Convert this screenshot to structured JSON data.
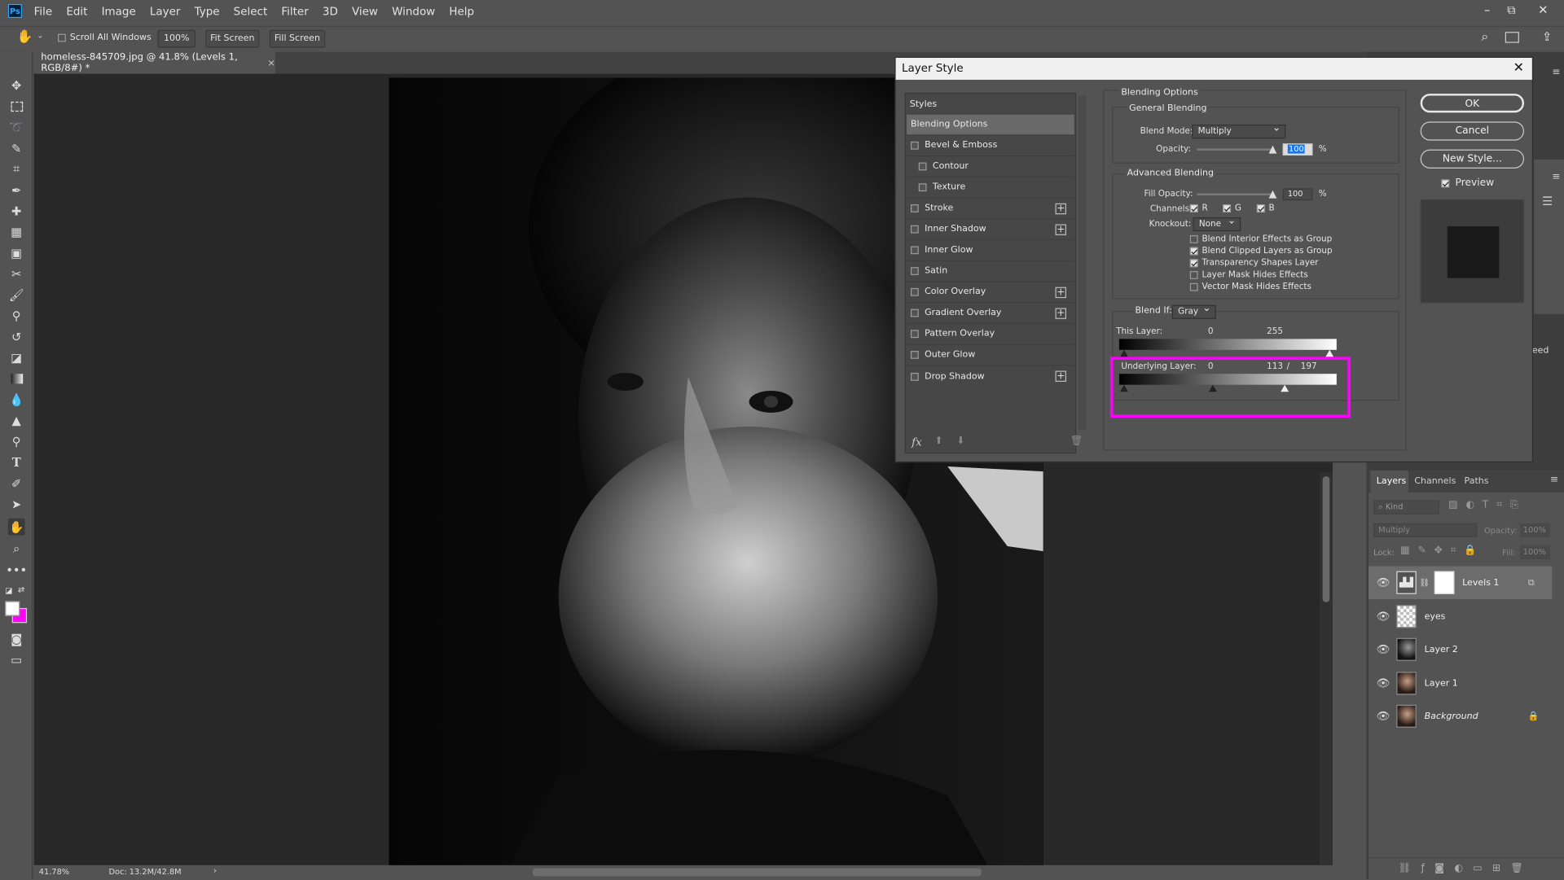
{
  "menubar": {
    "items": [
      "File",
      "Edit",
      "Image",
      "Layer",
      "Type",
      "Select",
      "Filter",
      "3D",
      "View",
      "Window",
      "Help"
    ],
    "logo": "Ps",
    "controls": [
      "–",
      "⧉",
      "✕"
    ]
  },
  "optionsbar": {
    "scroll_all": "Scroll All Windows",
    "zoom": "100%",
    "fit_screen": "Fit Screen",
    "fill_screen": "Fill Screen"
  },
  "document": {
    "tab_title": "homeless-845709.jpg @ 41.8% (Levels 1, RGB/8#) *",
    "close": "×"
  },
  "status": {
    "zoom": "41.78%",
    "doc": "Doc: 13.2M/42.8M"
  },
  "dialog": {
    "title": "Layer Style",
    "styles_header": "Styles",
    "style_items": [
      {
        "label": "Blending Options",
        "checkbox": false,
        "plus": false,
        "active": true
      },
      {
        "label": "Bevel & Emboss",
        "checkbox": true,
        "plus": false
      },
      {
        "label": "Contour",
        "checkbox": true,
        "plus": false,
        "indent": true
      },
      {
        "label": "Texture",
        "checkbox": true,
        "plus": false,
        "indent": true
      },
      {
        "label": "Stroke",
        "checkbox": true,
        "plus": true
      },
      {
        "label": "Inner Shadow",
        "checkbox": true,
        "plus": true
      },
      {
        "label": "Inner Glow",
        "checkbox": true,
        "plus": false
      },
      {
        "label": "Satin",
        "checkbox": true,
        "plus": false
      },
      {
        "label": "Color Overlay",
        "checkbox": true,
        "plus": true
      },
      {
        "label": "Gradient Overlay",
        "checkbox": true,
        "plus": true
      },
      {
        "label": "Pattern Overlay",
        "checkbox": true,
        "plus": false
      },
      {
        "label": "Outer Glow",
        "checkbox": true,
        "plus": false
      },
      {
        "label": "Drop Shadow",
        "checkbox": true,
        "plus": true
      }
    ],
    "fx_label": "fx",
    "blending_options": "Blending Options",
    "general_blending": "General Blending",
    "blend_mode_label": "Blend Mode:",
    "blend_mode": "Multiply",
    "opacity_label": "Opacity:",
    "opacity": "100",
    "percent": "%",
    "advanced_blending": "Advanced Blending",
    "fill_opacity_label": "Fill Opacity:",
    "fill_opacity": "100",
    "channels_label": "Channels:",
    "channels": [
      "R",
      "G",
      "B"
    ],
    "knockout_label": "Knockout:",
    "knockout": "None",
    "options": [
      {
        "label": "Blend Interior Effects as Group",
        "checked": false
      },
      {
        "label": "Blend Clipped Layers as Group",
        "checked": true
      },
      {
        "label": "Transparency Shapes Layer",
        "checked": true
      },
      {
        "label": "Layer Mask Hides Effects",
        "checked": false
      },
      {
        "label": "Vector Mask Hides Effects",
        "checked": false
      }
    ],
    "blend_if_label": "Blend If:",
    "blend_if": "Gray",
    "this_layer_label": "This Layer:",
    "this_layer_low": "0",
    "this_layer_high": "255",
    "underlying_label": "Underlying Layer:",
    "underlying_low": "0",
    "underlying_split_a": "113",
    "underlying_sep": "/",
    "underlying_split_b": "197",
    "buttons": {
      "ok": "OK",
      "cancel": "Cancel",
      "new_style": "New Style...",
      "preview": "Preview"
    },
    "highlight_color": "#ff00ff"
  },
  "layers_panel": {
    "tabs": [
      "Layers",
      "Channels",
      "Paths"
    ],
    "kind": "Kind",
    "blend": "Multiply",
    "opacity_label": "Opacity:",
    "opacity": "100%",
    "lock_label": "Lock:",
    "fill_label": "Fill:",
    "fill": "100%",
    "layers": [
      {
        "name": "Levels 1",
        "selected": true
      },
      {
        "name": "eyes"
      },
      {
        "name": "Layer 2"
      },
      {
        "name": "Layer 1"
      },
      {
        "name": "Background",
        "locked": true
      }
    ],
    "partial_text": "eed"
  },
  "colors": {
    "foreground": "#ffffff",
    "background": "#ff00ff"
  }
}
